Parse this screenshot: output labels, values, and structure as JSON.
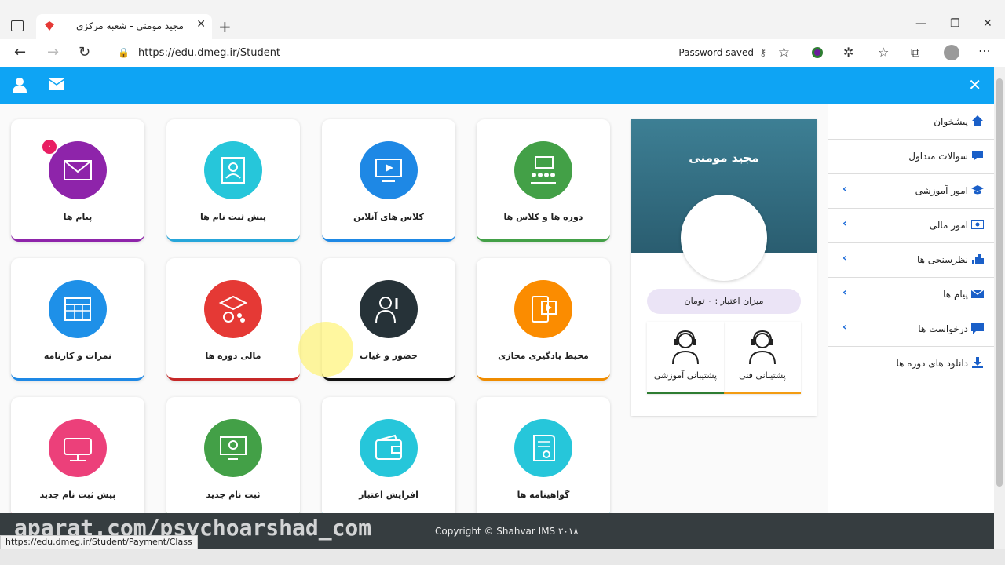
{
  "browser": {
    "tab_title": "مجید مومنی - شعبه مرکزی",
    "url": "https://edu.dmeg.ir/Student",
    "password_saved": "Password saved"
  },
  "cards": [
    {
      "label": "پیام ها",
      "color": "#8e24aa",
      "border": "#8e24aa",
      "icon": "envelope-icon",
      "badge": "۰"
    },
    {
      "label": "پیش ثبت نام ها",
      "color": "#26c6da",
      "border": "#26a6da",
      "icon": "certificate-person-icon"
    },
    {
      "label": "کلاس های آنلاین",
      "color": "#1e88e5",
      "border": "#1e88e5",
      "icon": "online-class-icon"
    },
    {
      "label": "دوره ها و کلاس ها",
      "color": "#43a047",
      "border": "#43a047",
      "icon": "classroom-icon"
    },
    {
      "label": "نمرات و کارنامه",
      "color": "#1e90e8",
      "border": "#1e88e5",
      "icon": "score-icon"
    },
    {
      "label": "مالی دوره ها",
      "color": "#e53935",
      "border": "#c62828",
      "icon": "graduation-money-icon"
    },
    {
      "label": "حضور و غیاب",
      "color": "#263238",
      "border": "#111111",
      "icon": "attendance-icon"
    },
    {
      "label": "محیط یادگیری مجازی",
      "color": "#fb8c00",
      "border": "#ef8c00",
      "icon": "virtual-learning-icon"
    },
    {
      "label": "پیش ثبت نام جدید",
      "color": "#ec407a",
      "border": "#ec407a",
      "icon": "reserved-icon"
    },
    {
      "label": "ثبت نام جدید",
      "color": "#43a047",
      "border": "#43a047",
      "icon": "register-icon"
    },
    {
      "label": "افزایش اعتبار",
      "color": "#26c6da",
      "border": "#26c6da",
      "icon": "wallet-icon"
    },
    {
      "label": "گواهینامه ها",
      "color": "#26c6da",
      "border": "#26c6da",
      "icon": "certificate-icon"
    }
  ],
  "profile": {
    "name": "مجید مومنی",
    "credit": "میزان اعتبار : ۰ تومان",
    "support_tech": "پشتیبانی فنی",
    "support_edu": "پشتیبانی آموزشی"
  },
  "sidebar": {
    "items": [
      {
        "label": "پیشخوان",
        "icon": "home-icon",
        "chevron": false
      },
      {
        "label": "سوالات متداول",
        "icon": "chat-icon",
        "chevron": false
      },
      {
        "label": "امور آموزشی",
        "icon": "graduation-cap-icon",
        "chevron": true
      },
      {
        "label": "امور مالی",
        "icon": "money-icon",
        "chevron": true
      },
      {
        "label": "نظرسنجی ها",
        "icon": "bar-chart-icon",
        "chevron": true
      },
      {
        "label": "پیام ها",
        "icon": "envelope-icon",
        "chevron": true
      },
      {
        "label": "درخواست ها",
        "icon": "comment-icon",
        "chevron": true
      },
      {
        "label": "دانلود های دوره ها",
        "icon": "download-icon",
        "chevron": false
      }
    ]
  },
  "footer": {
    "watermark": "aparat.com/psychoarshad_com",
    "copyright": "Copyright © Shahvar IMS ۲۰۱۸"
  },
  "status_url": "https://edu.dmeg.ir/Student/Payment/Class",
  "colors": {
    "accent": "#0ea4f4",
    "footer": "#363d40"
  }
}
